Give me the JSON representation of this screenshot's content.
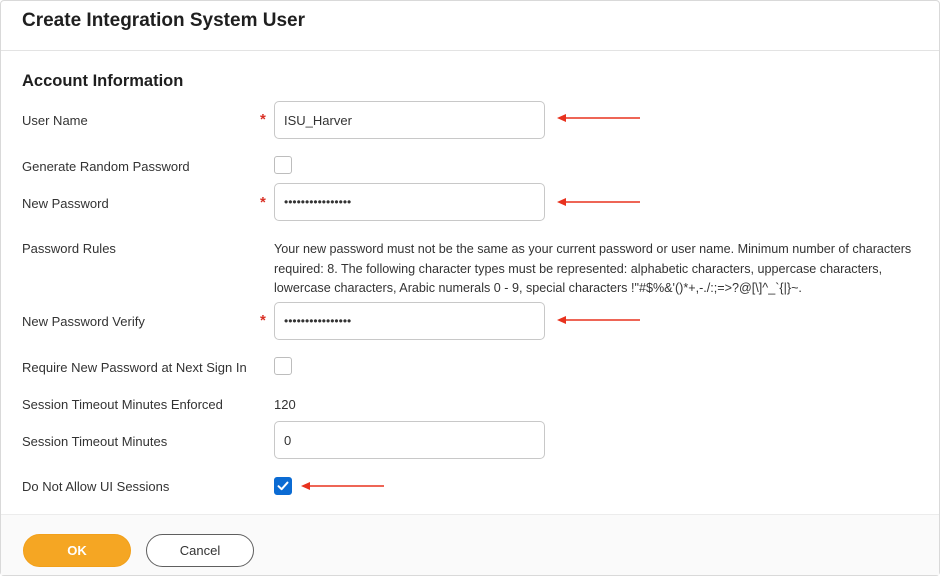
{
  "dialog": {
    "title": "Create Integration System User"
  },
  "section": {
    "title": "Account Information"
  },
  "fields": {
    "user_name": {
      "label": "User Name",
      "value": "ISU_Harver",
      "required": "*"
    },
    "generate_random_password": {
      "label": "Generate Random Password",
      "checked": false
    },
    "new_password": {
      "label": "New Password",
      "value": "••••••••••••••••",
      "required": "*"
    },
    "password_rules": {
      "label": "Password Rules",
      "text": "Your new password must not be the same as your current password or user name. Minimum number of characters required: 8. The following character types must be represented: alphabetic characters, uppercase characters, lowercase characters, Arabic numerals 0 - 9, special characters !\"#$%&'()*+,-./:;=>?@[\\]^_`{|}~."
    },
    "new_password_verify": {
      "label": "New Password Verify",
      "value": "••••••••••••••••",
      "required": "*"
    },
    "require_new_password": {
      "label": "Require New Password at Next Sign In",
      "checked": false
    },
    "session_timeout_enforced": {
      "label": "Session Timeout Minutes Enforced",
      "value": "120"
    },
    "session_timeout_minutes": {
      "label": "Session Timeout Minutes",
      "value": "0"
    },
    "do_not_allow_ui_sessions": {
      "label": "Do Not Allow UI Sessions",
      "checked": true
    }
  },
  "buttons": {
    "ok": "OK",
    "cancel": "Cancel"
  },
  "colors": {
    "required_star": "#d93025",
    "annotation_arrow": "#e8321e",
    "ok_button": "#f5a623",
    "checkbox_checked": "#0b6bd3"
  },
  "icons": {
    "annotation": "left-arrow-icon",
    "check": "checkmark-icon"
  }
}
